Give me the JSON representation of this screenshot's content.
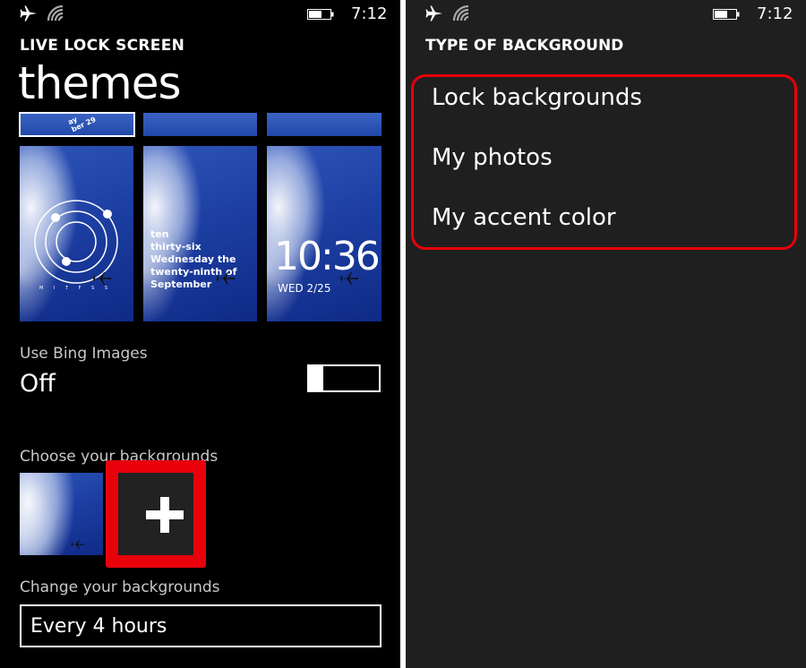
{
  "left_screen": {
    "status": {
      "time": "7:12"
    },
    "app_title": "LIVE LOCK SCREEN",
    "page_title": "themes",
    "tiles": [
      {
        "style": "analog",
        "dots_text": "M I T F S S"
      },
      {
        "style": "words",
        "lines": [
          "ten",
          "thirty-six",
          "Wednesday the",
          "twenty-ninth of",
          "September"
        ]
      },
      {
        "style": "digital",
        "time": "10:36",
        "date": "WED 2/25"
      }
    ],
    "top_tile_text": "ay\nber 29",
    "bing": {
      "label": "Use Bing Images",
      "value": "Off"
    },
    "choose_label": "Choose your backgrounds",
    "change_label": "Change your backgrounds",
    "change_value": "Every 4 hours",
    "highlight_color": "#e8000b"
  },
  "right_screen": {
    "status": {
      "time": "7:12"
    },
    "title": "TYPE OF BACKGROUND",
    "options": [
      "Lock backgrounds",
      "My photos",
      "My accent color"
    ]
  },
  "icons": {
    "airplane": "airplane-icon",
    "signal": "signal-icon",
    "battery": "battery-icon",
    "add": "plus-icon"
  }
}
